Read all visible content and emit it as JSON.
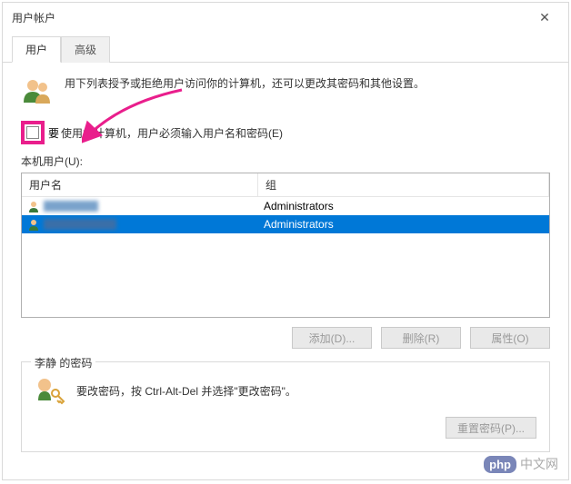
{
  "window": {
    "title": "用户帐户",
    "close_glyph": "✕"
  },
  "tabs": {
    "user": "用户",
    "advanced": "高级"
  },
  "intro": "用下列表授予或拒绝用户访问你的计算机，还可以更改其密码和其他设置。",
  "checkbox_label_partial": "使用本计算机，用户必须输入用户名和密码(E)",
  "checkbox_hidden_prefix": "要",
  "list_label": "本机用户(U):",
  "columns": {
    "username": "用户名",
    "group": "组"
  },
  "rows": [
    {
      "group": "Administrators",
      "selected": false
    },
    {
      "group": "Administrators",
      "selected": true
    }
  ],
  "buttons": {
    "add": "添加(D)...",
    "remove": "删除(R)",
    "properties": "属性(O)",
    "reset_password": "重置密码(P)..."
  },
  "password_group": {
    "title": "李静 的密码",
    "text": "要改密码，按 Ctrl-Alt-Del 并选择\"更改密码\"。"
  },
  "watermark": {
    "php": "php",
    "cn": "中文网"
  },
  "colors": {
    "highlight": "#e91e8c",
    "selection": "#0078d7"
  }
}
